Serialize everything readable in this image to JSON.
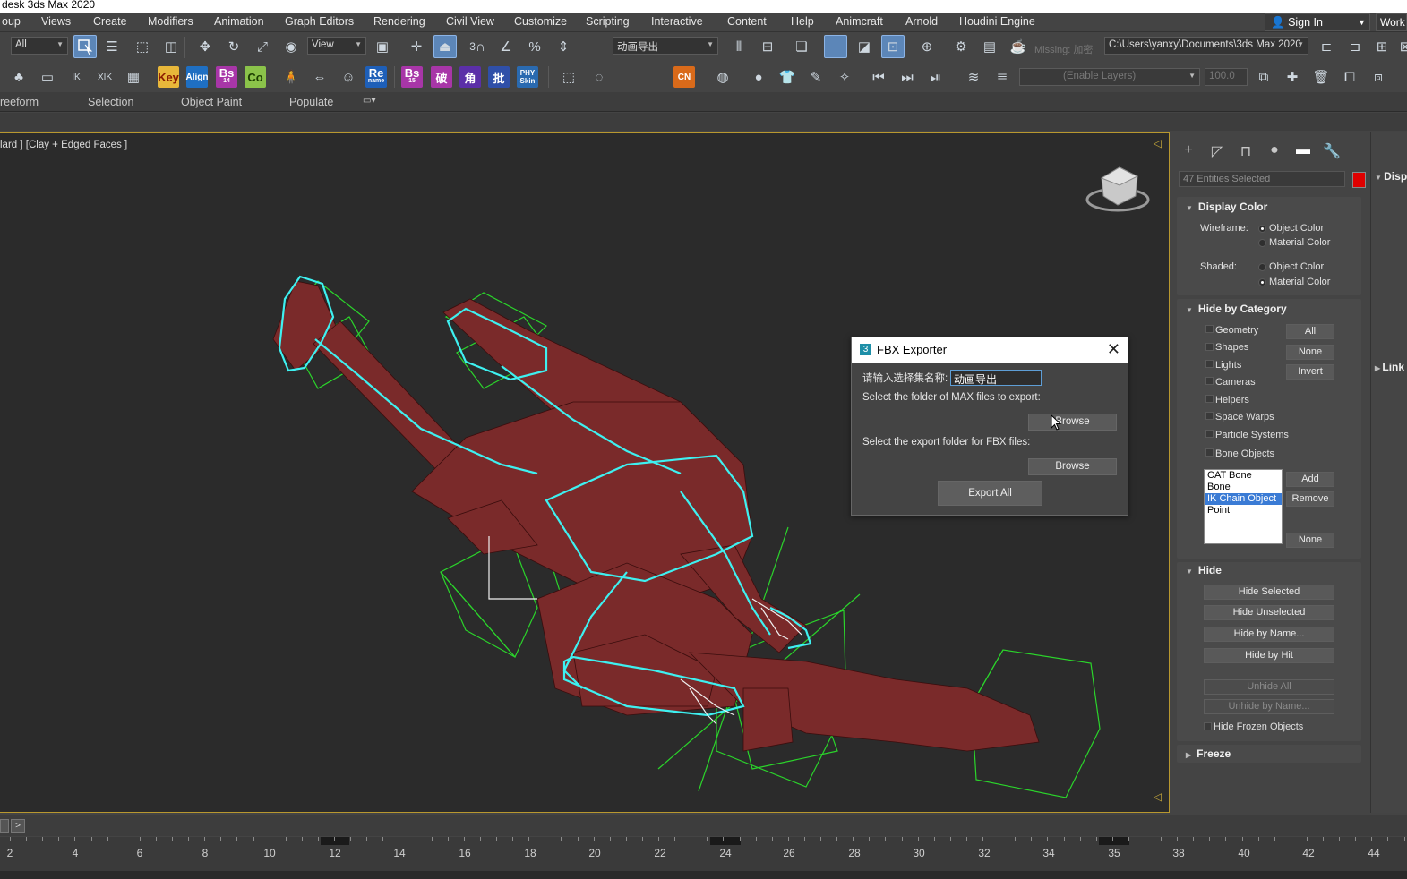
{
  "window": {
    "title": "desk 3ds Max 2020"
  },
  "menus": [
    "oup",
    "Views",
    "Create",
    "Modifiers",
    "Animation",
    "Graph Editors",
    "Rendering",
    "Civil View",
    "Customize",
    "Scripting",
    "Interactive",
    "Content",
    "Help",
    "Animcraft",
    "Arnold",
    "Houdini Engine"
  ],
  "account": {
    "signin": "Sign In",
    "workspace": "Work"
  },
  "toolbar1": {
    "filter": "All",
    "refcoord": "View",
    "snap_label": "3",
    "named_selection": "动画导出",
    "missing_label": "Missing: 加密",
    "project_path": "C:\\Users\\yanxy\\Documents\\3ds Max 2020"
  },
  "toolbar2": {
    "key_label": "Key",
    "align_label": "Align",
    "bs14_label": "Bs",
    "bs14_sub": "14",
    "co_label": "Co",
    "re_label": "Re",
    "re_sub": "name",
    "bs15_label": "Bs",
    "bs15_sub": "15",
    "po_label": "破",
    "jiao_label": "角",
    "pi_label": "批",
    "phy_label": "PHY",
    "phy_sub": "Skin",
    "cn_label": "CN",
    "layers_placeholder": "(Enable Layers)",
    "opacity_value": "100.0"
  },
  "ribbon": {
    "tabs": [
      "reeform",
      "Selection",
      "Object Paint",
      "Populate"
    ]
  },
  "viewport": {
    "label": "lard ] [Clay + Edged Faces ]"
  },
  "fbx_dialog": {
    "title": "FBX Exporter",
    "prompt": "请输入选择集名称:",
    "set_name": "动画导出",
    "max_folder_label": "Select the folder of MAX files to export:",
    "browse1": "Browse",
    "fbx_folder_label": "Select the export folder for FBX files:",
    "browse2": "Browse",
    "export_all": "Export All"
  },
  "command_panel": {
    "entities": "47 Entities Selected",
    "swatch_color": "#e00000",
    "display_color": {
      "title": "Display Color",
      "wireframe_label": "Wireframe:",
      "shaded_label": "Shaded:",
      "object_color": "Object Color",
      "material_color": "Material Color"
    },
    "hide_by_category": {
      "title": "Hide by Category",
      "items": [
        "Geometry",
        "Shapes",
        "Lights",
        "Cameras",
        "Helpers",
        "Space Warps",
        "Particle Systems",
        "Bone Objects"
      ],
      "all": "All",
      "none": "None",
      "invert": "Invert",
      "list": [
        "CAT Bone",
        "Bone",
        "IK Chain Object",
        "Point"
      ],
      "list_selected": "IK Chain Object",
      "add": "Add",
      "remove": "Remove",
      "none2": "None"
    },
    "hide": {
      "title": "Hide",
      "hide_selected": "Hide Selected",
      "hide_unselected": "Hide Unselected",
      "hide_by_name": "Hide by Name...",
      "hide_by_hit": "Hide by Hit",
      "unhide_all": "Unhide All",
      "unhide_by_name": "Unhide by Name...",
      "hide_frozen": "Hide Frozen Objects"
    },
    "freeze": {
      "title": "Freeze"
    }
  },
  "side_strip": {
    "disp": "Disp",
    "link": "Link"
  },
  "timeline": {
    "arrow": ">",
    "ticks": [
      "2",
      "4",
      "6",
      "8",
      "10",
      "12",
      "14",
      "16",
      "18",
      "20",
      "22",
      "24",
      "26",
      "28",
      "30",
      "32",
      "34",
      "35",
      "38",
      "40",
      "42",
      "44"
    ]
  }
}
